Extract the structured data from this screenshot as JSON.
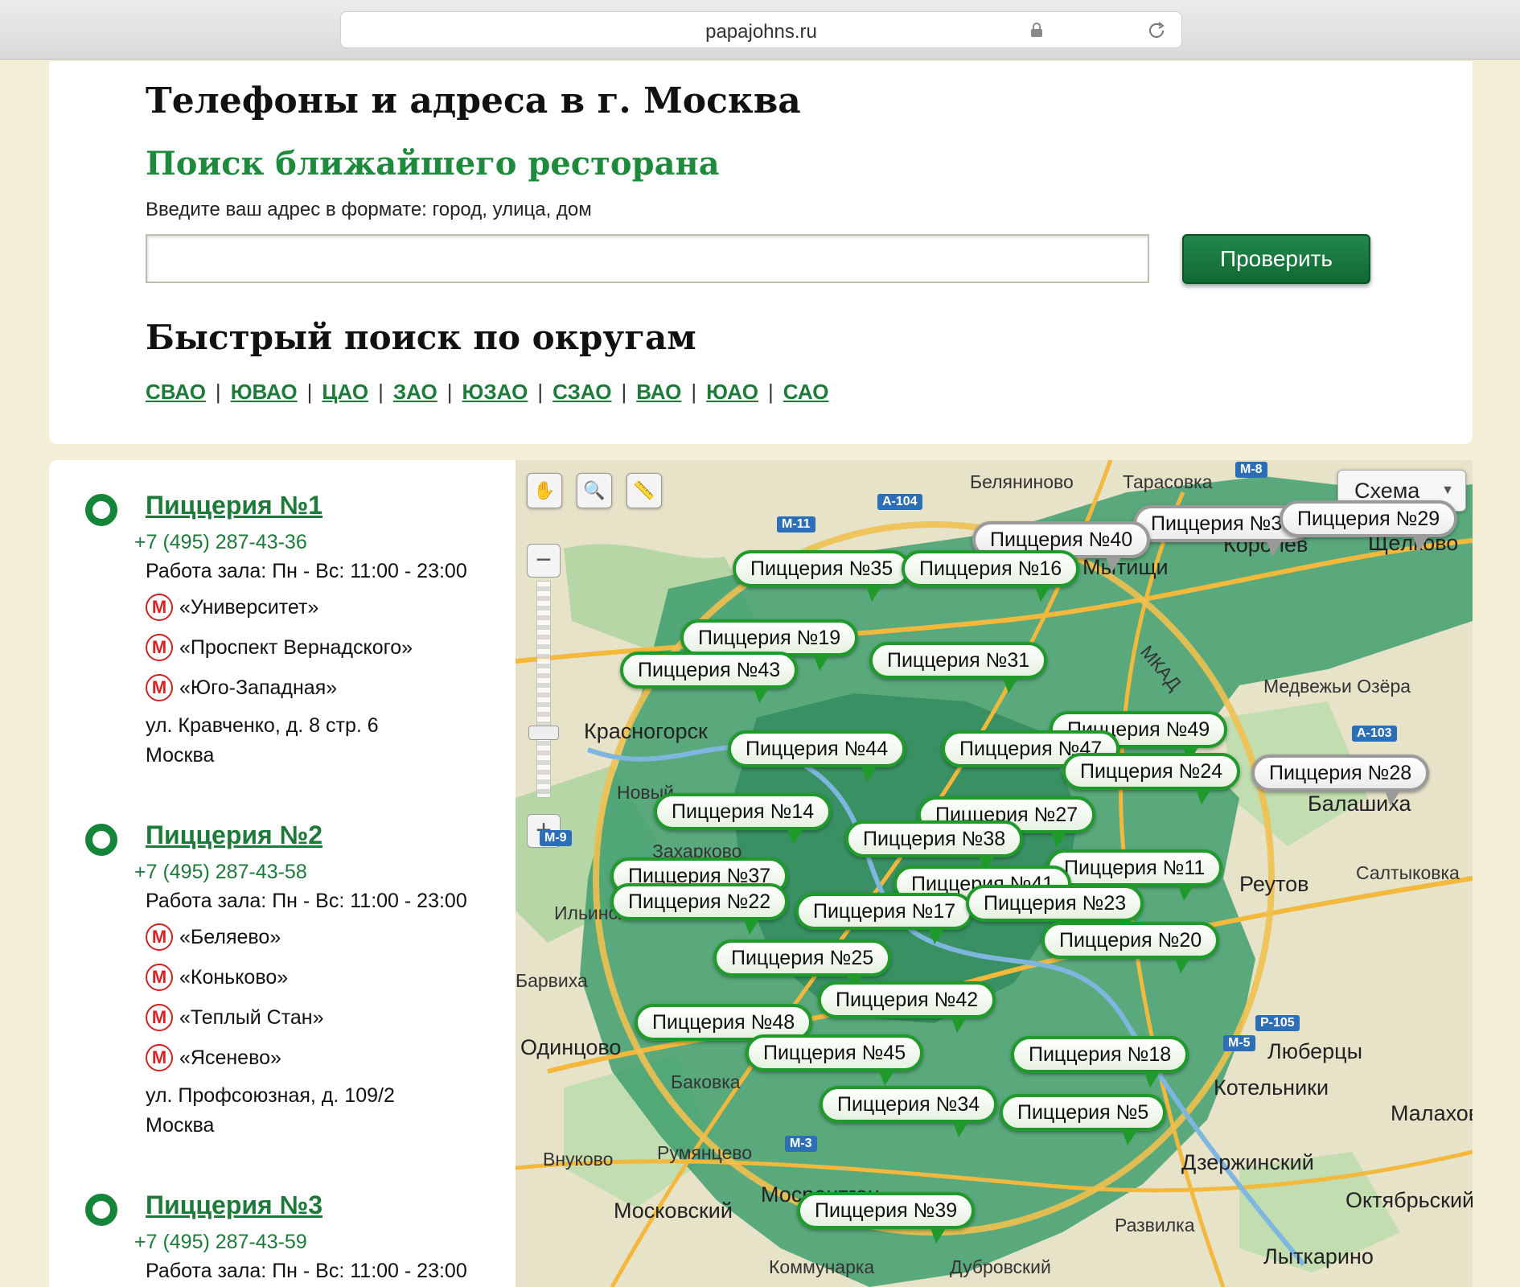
{
  "browser": {
    "url": "papajohns.ru"
  },
  "header": {
    "title": "Телефоны и адреса в г. Москва",
    "search_title": "Поиск ближайшего ресторана",
    "search_hint": "Введите ваш адрес в формате: город, улица, дом",
    "search_value": "",
    "check_label": "Проверить",
    "quick_title": "Быстрый поиск по округам",
    "districts": [
      "СВАО",
      "ЮВАО",
      "ЦАО",
      "ЗАО",
      "ЮЗАО",
      "СЗАО",
      "ВАО",
      "ЮАО",
      "САО"
    ]
  },
  "list": [
    {
      "title": "Пиццерия №1",
      "phone": "+7 (495) 287-43-36",
      "hours": "Работа зала: Пн - Вс: 11:00 - 23:00",
      "metro": [
        "«Университет»",
        "«Проспект Вернадского»",
        "«Юго-Западная»"
      ],
      "address1": "ул. Кравченко, д. 8 стр. 6",
      "address2": "Москва"
    },
    {
      "title": "Пиццерия №2",
      "phone": "+7 (495) 287-43-58",
      "hours": "Работа зала: Пн - Вс: 11:00 - 23:00",
      "metro": [
        "«Беляево»",
        "«Коньково»",
        "«Теплый Стан»",
        "«Ясенево»"
      ],
      "address1": "ул. Профсоюзная, д. 109/2",
      "address2": "Москва"
    },
    {
      "title": "Пиццерия №3",
      "phone": "+7 (495) 287-43-59",
      "hours": "Работа зала: Пн - Вс: 11:00 - 23:00"
    }
  ],
  "map": {
    "layer_label": "Схема",
    "zoom_in": "+",
    "zoom_out": "−",
    "places": [
      "Беляниново",
      "Тарасовка",
      "Мытищи",
      "Королёв",
      "Щёлково",
      "Медвежьи Озёра",
      "Красногорск",
      "Новый",
      "Захарково",
      "Ильинское",
      "Барвиха",
      "Одинцово",
      "Баковка",
      "Внуково",
      "Румянцево",
      "Московский",
      "Мосрентген",
      "Коммунарка",
      "Дубровский",
      "Развилка",
      "Реутов",
      "Салтыковка",
      "Балашиха",
      "Люберцы",
      "Котельники",
      "Дзержинский",
      "Малаховка",
      "Октябрьский",
      "Лыткарино",
      "МКАД"
    ],
    "roads": [
      "А-104",
      "М-11",
      "М-8",
      "А-103",
      "М-9",
      "Р-105",
      "М-5",
      "М-3"
    ],
    "markers": [
      "Пиццерия №33",
      "Пиццерия №29",
      "Пиццерия №40",
      "Пиццерия №35",
      "Пиццерия №16",
      "Пиццерия №19",
      "Пиццерия №43",
      "Пиццерия №31",
      "Пиццерия №49",
      "Пиццерия №47",
      "Пиццерия №44",
      "Пиццерия №24",
      "Пиццерия №28",
      "Пиццерия №14",
      "Пиццерия №27",
      "Пиццерия №38",
      "Пиццерия №11",
      "Пиццерия №37",
      "Пиццерия №22",
      "Пиццерия №41",
      "Пиццерия №17",
      "Пиццерия №23",
      "Пиццерия №20",
      "Пиццерия №25",
      "Пиццерия №42",
      "Пиццерия №48",
      "Пиццерия №45",
      "Пиццерия №18",
      "Пиццерия №34",
      "Пиццерия №5",
      "Пиццерия №39"
    ],
    "colors": {
      "district_green": "#3f9f6e",
      "marker_green": "#1f9a2b"
    }
  }
}
